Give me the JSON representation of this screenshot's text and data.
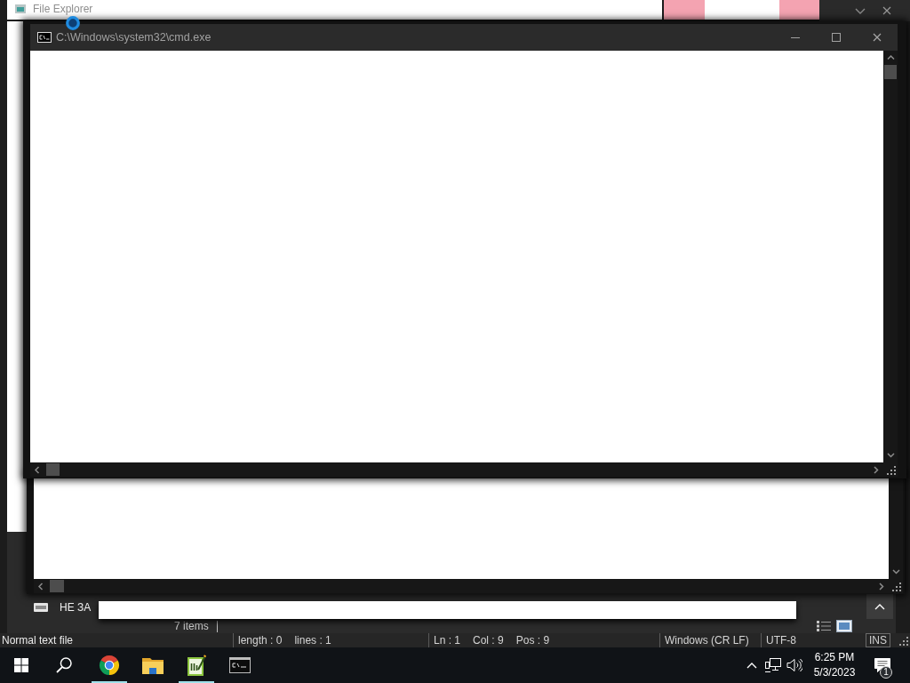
{
  "background_window": {
    "tabs": [
      {
        "color": "#ffffff"
      },
      {
        "color": "#f4a3b1"
      },
      {
        "color": "#ffffff"
      },
      {
        "color": "#f4a3b1"
      }
    ],
    "status_bar": {
      "file_type": "Normal text file",
      "length": "length : 0",
      "lines": "lines : 1",
      "line": "Ln : 1",
      "column": "Col : 9",
      "position": "Pos : 9",
      "line_ending": "Windows (CR LF)",
      "encoding": "UTF-8",
      "mode": "INS"
    }
  },
  "explorer_window": {
    "title": "File Explorer",
    "nav_item": "НЕ ЗА",
    "status": "7 items"
  },
  "console_window": {
    "title": "C:\\Windows\\system32\\cmd.exe"
  },
  "taskbar": {
    "apps": [
      {
        "kind": "start",
        "running": false
      },
      {
        "kind": "search",
        "running": false
      },
      {
        "kind": "browser",
        "running": true
      },
      {
        "kind": "folder",
        "running": false
      },
      {
        "kind": "notepad",
        "running": true
      },
      {
        "kind": "console",
        "running": false
      }
    ],
    "tray": {
      "time": "6:25 PM",
      "date": "5/3/2023",
      "notifications": "1"
    }
  }
}
